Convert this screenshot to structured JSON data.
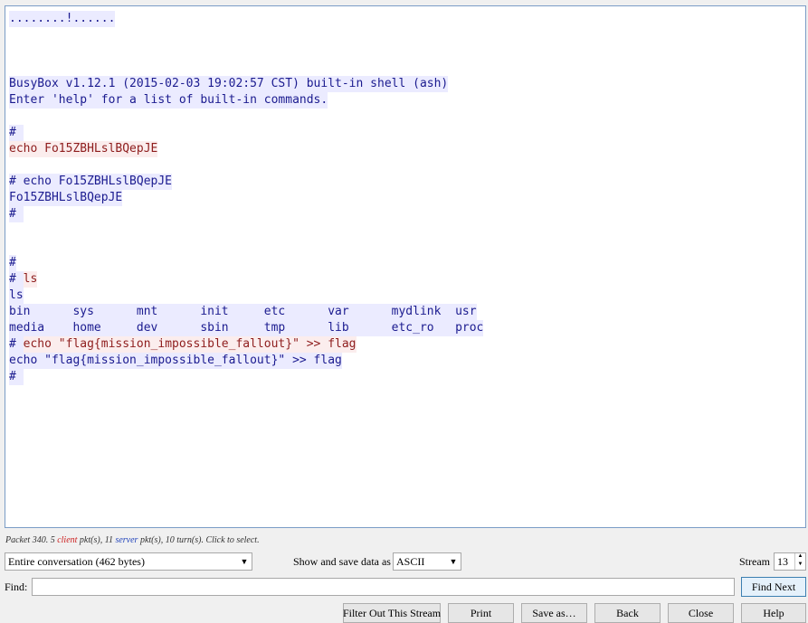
{
  "stream": {
    "lines": [
      [
        {
          "dir": "server",
          "text": "........!......"
        }
      ],
      [],
      [],
      [],
      [
        {
          "dir": "server",
          "text": "BusyBox v1.12.1 (2015-02-03 19:02:57 CST) built-in shell (ash)"
        }
      ],
      [
        {
          "dir": "server",
          "text": "Enter 'help' for a list of built-in commands."
        }
      ],
      [],
      [
        {
          "dir": "server",
          "text": "# "
        }
      ],
      [
        {
          "dir": "client",
          "text": "echo Fo15ZBHLslBQepJE"
        }
      ],
      [],
      [
        {
          "dir": "server",
          "text": "# echo Fo15ZBHLslBQepJE"
        }
      ],
      [
        {
          "dir": "server",
          "text": "Fo15ZBHLslBQepJE"
        }
      ],
      [
        {
          "dir": "server",
          "text": "# "
        }
      ],
      [],
      [],
      [
        {
          "dir": "server",
          "text": "#"
        }
      ],
      [
        {
          "dir": "server",
          "text": "# "
        },
        {
          "dir": "client",
          "text": "ls"
        }
      ],
      [
        {
          "dir": "server",
          "text": "ls"
        }
      ],
      [
        {
          "dir": "server",
          "text": "bin      sys      mnt      init     etc      var      mydlink  usr"
        }
      ],
      [
        {
          "dir": "server",
          "text": "media    home     dev      sbin     tmp      lib      etc_ro   proc"
        }
      ],
      [
        {
          "dir": "server",
          "text": "# "
        },
        {
          "dir": "client",
          "text": "echo \"flag{mission_impossible_fallout}\" >> flag"
        }
      ],
      [
        {
          "dir": "server",
          "text": "echo \"flag{mission_impossible_fallout}\" >> flag"
        }
      ],
      [
        {
          "dir": "server",
          "text": "# "
        }
      ]
    ]
  },
  "status": {
    "prefix": "Packet 340. 5 ",
    "client": "client",
    "mid1": " pkt(s), 11 ",
    "server": "server",
    "suffix": " pkt(s), 10 turn(s). Click to select."
  },
  "controls": {
    "conversation_select": "Entire conversation (462 bytes)",
    "show_label": "Show and save data as",
    "format_select": "ASCII",
    "stream_label": "Stream",
    "stream_value": "13",
    "find_label": "Find:",
    "find_value": "",
    "find_next": "Find Next"
  },
  "buttons": {
    "filter_out": "Filter Out This Stream",
    "print": "Print",
    "save_as": "Save as…",
    "back": "Back",
    "close": "Close",
    "help": "Help"
  }
}
